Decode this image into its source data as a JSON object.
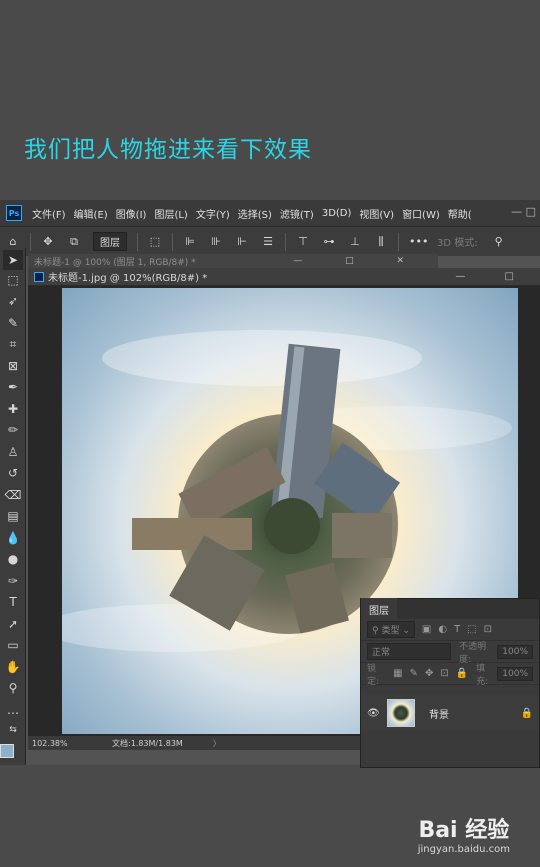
{
  "caption": "我们把人物拖进来看下效果",
  "app": {
    "logo": "Ps",
    "menu": [
      "文件(F)",
      "编辑(E)",
      "图像(I)",
      "图层(L)",
      "文字(Y)",
      "选择(S)",
      "滤镜(T)",
      "3D(D)",
      "视图(V)",
      "窗口(W)",
      "帮助("
    ],
    "window_controls": "— □"
  },
  "options_bar": {
    "layer_select": "图层",
    "mode_3d": "3D 模式:"
  },
  "documents": {
    "back_tab": "未标题-1 @ 100% (图层 1, RGB/8#) *",
    "active_title": "未标题-1.jpg @ 102%(RGB/8#) *",
    "back_controls": "— □ ✕",
    "active_controls": "— □"
  },
  "status": {
    "zoom": "102.38%",
    "doc_size": "文档:1.83M/1.83M",
    "arrow": "〉"
  },
  "colors": {
    "foreground": "#8fb0c8",
    "background": "#ffffff",
    "accent": "#2ad6e6"
  },
  "layers_panel": {
    "tab": "图层",
    "filter_placeholder": "类型",
    "blend_mode": "正常",
    "opacity_label": "不透明度:",
    "opacity_value": "100%",
    "lock_label": "锁定:",
    "fill_label": "填充:",
    "fill_value": "100%",
    "layers": [
      {
        "name": "背景",
        "visible": true,
        "locked": true
      }
    ]
  },
  "watermark": {
    "brand": "Bai 经验",
    "url": "jingyan.baidu.com"
  }
}
